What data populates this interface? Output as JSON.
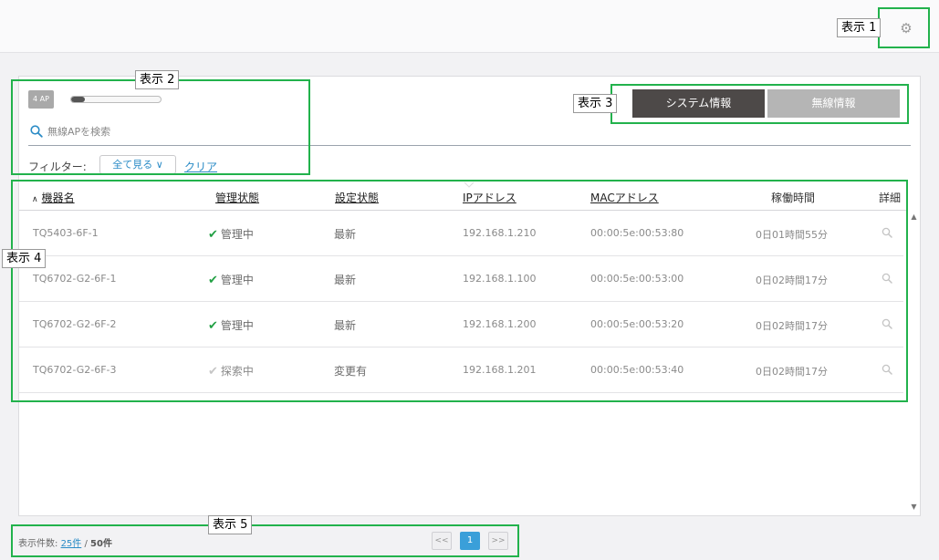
{
  "header": {
    "settings_icon": "gear-icon"
  },
  "ap_summary": {
    "badge": "4 AP",
    "progress": 0.15
  },
  "search": {
    "placeholder": "無線APを検索",
    "value": ""
  },
  "filter": {
    "label": "フィルター:",
    "dropdown_value": "全て見る ∨",
    "clear_label": "クリア"
  },
  "tabs": [
    {
      "label": "システム情報",
      "active": true
    },
    {
      "label": "無線情報",
      "active": false
    }
  ],
  "table": {
    "sort_indicator": "∧",
    "columns": [
      "機器名",
      "管理状態",
      "設定状態",
      "IPアドレス",
      "MACアドレス",
      "稼働時間",
      "詳細"
    ],
    "rows": [
      {
        "name": "TQ5403-6F-1",
        "status": "管理中",
        "managed": true,
        "config": "最新",
        "ip": "192.168.1.210",
        "mac": "00:00:5e:00:53:80",
        "uptime": "0日01時間55分"
      },
      {
        "name": "TQ6702-G2-6F-1",
        "status": "管理中",
        "managed": true,
        "config": "最新",
        "ip": "192.168.1.100",
        "mac": "00:00:5e:00:53:00",
        "uptime": "0日02時間17分"
      },
      {
        "name": "TQ6702-G2-6F-2",
        "status": "管理中",
        "managed": true,
        "config": "最新",
        "ip": "192.168.1.200",
        "mac": "00:00:5e:00:53:20",
        "uptime": "0日02時間17分"
      },
      {
        "name": "TQ6702-G2-6F-3",
        "status": "探索中",
        "managed": false,
        "config": "変更有",
        "ip": "192.168.1.201",
        "mac": "00:00:5e:00:53:40",
        "uptime": "0日02時間17分"
      }
    ]
  },
  "footer": {
    "count_label": "表示件数:",
    "per_page": "25件",
    "separator": " / ",
    "total": "50件",
    "pagination": {
      "prev": "<<",
      "current": "1",
      "next": ">>"
    }
  },
  "annotations": [
    "表示 1",
    "表示 2",
    "表示 3",
    "表示 4",
    "表示 5"
  ],
  "colors": {
    "accent": "#2a8bc6",
    "active_tab": "#4d4948",
    "inactive_tab": "#b5b5b5",
    "annotation": "#22b24c",
    "check": "#22a044",
    "page_active": "#3a9fd9"
  }
}
